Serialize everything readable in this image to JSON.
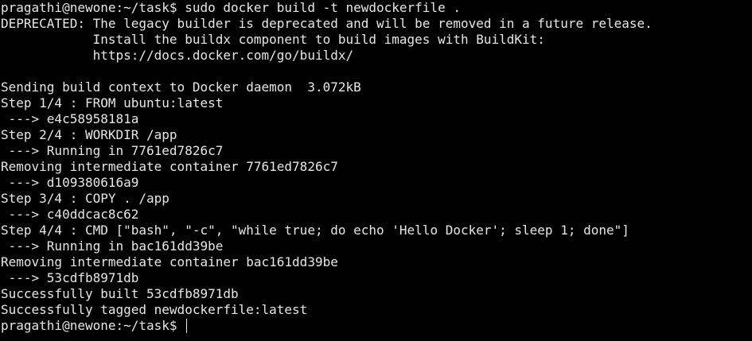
{
  "terminal": {
    "lines": [
      "pragathi@newone:~/task$ sudo docker build -t newdockerfile .",
      "DEPRECATED: The legacy builder is deprecated and will be removed in a future release.",
      "            Install the buildx component to build images with BuildKit:",
      "            https://docs.docker.com/go/buildx/",
      "",
      "Sending build context to Docker daemon  3.072kB",
      "Step 1/4 : FROM ubuntu:latest",
      " ---> e4c58958181a",
      "Step 2/4 : WORKDIR /app",
      " ---> Running in 7761ed7826c7",
      "Removing intermediate container 7761ed7826c7",
      " ---> d109380616a9",
      "Step 3/4 : COPY . /app",
      " ---> c40ddcac8c62",
      "Step 4/4 : CMD [\"bash\", \"-c\", \"while true; do echo 'Hello Docker'; sleep 1; done\"]",
      " ---> Running in bac161dd39be",
      "Removing intermediate container bac161dd39be",
      " ---> 53cdfb8971db",
      "Successfully built 53cdfb8971db",
      "Successfully tagged newdockerfile:latest"
    ],
    "prompt": "pragathi@newone:~/task$ "
  },
  "colors": {
    "background": "#000000",
    "foreground": "#e6e6e6"
  }
}
